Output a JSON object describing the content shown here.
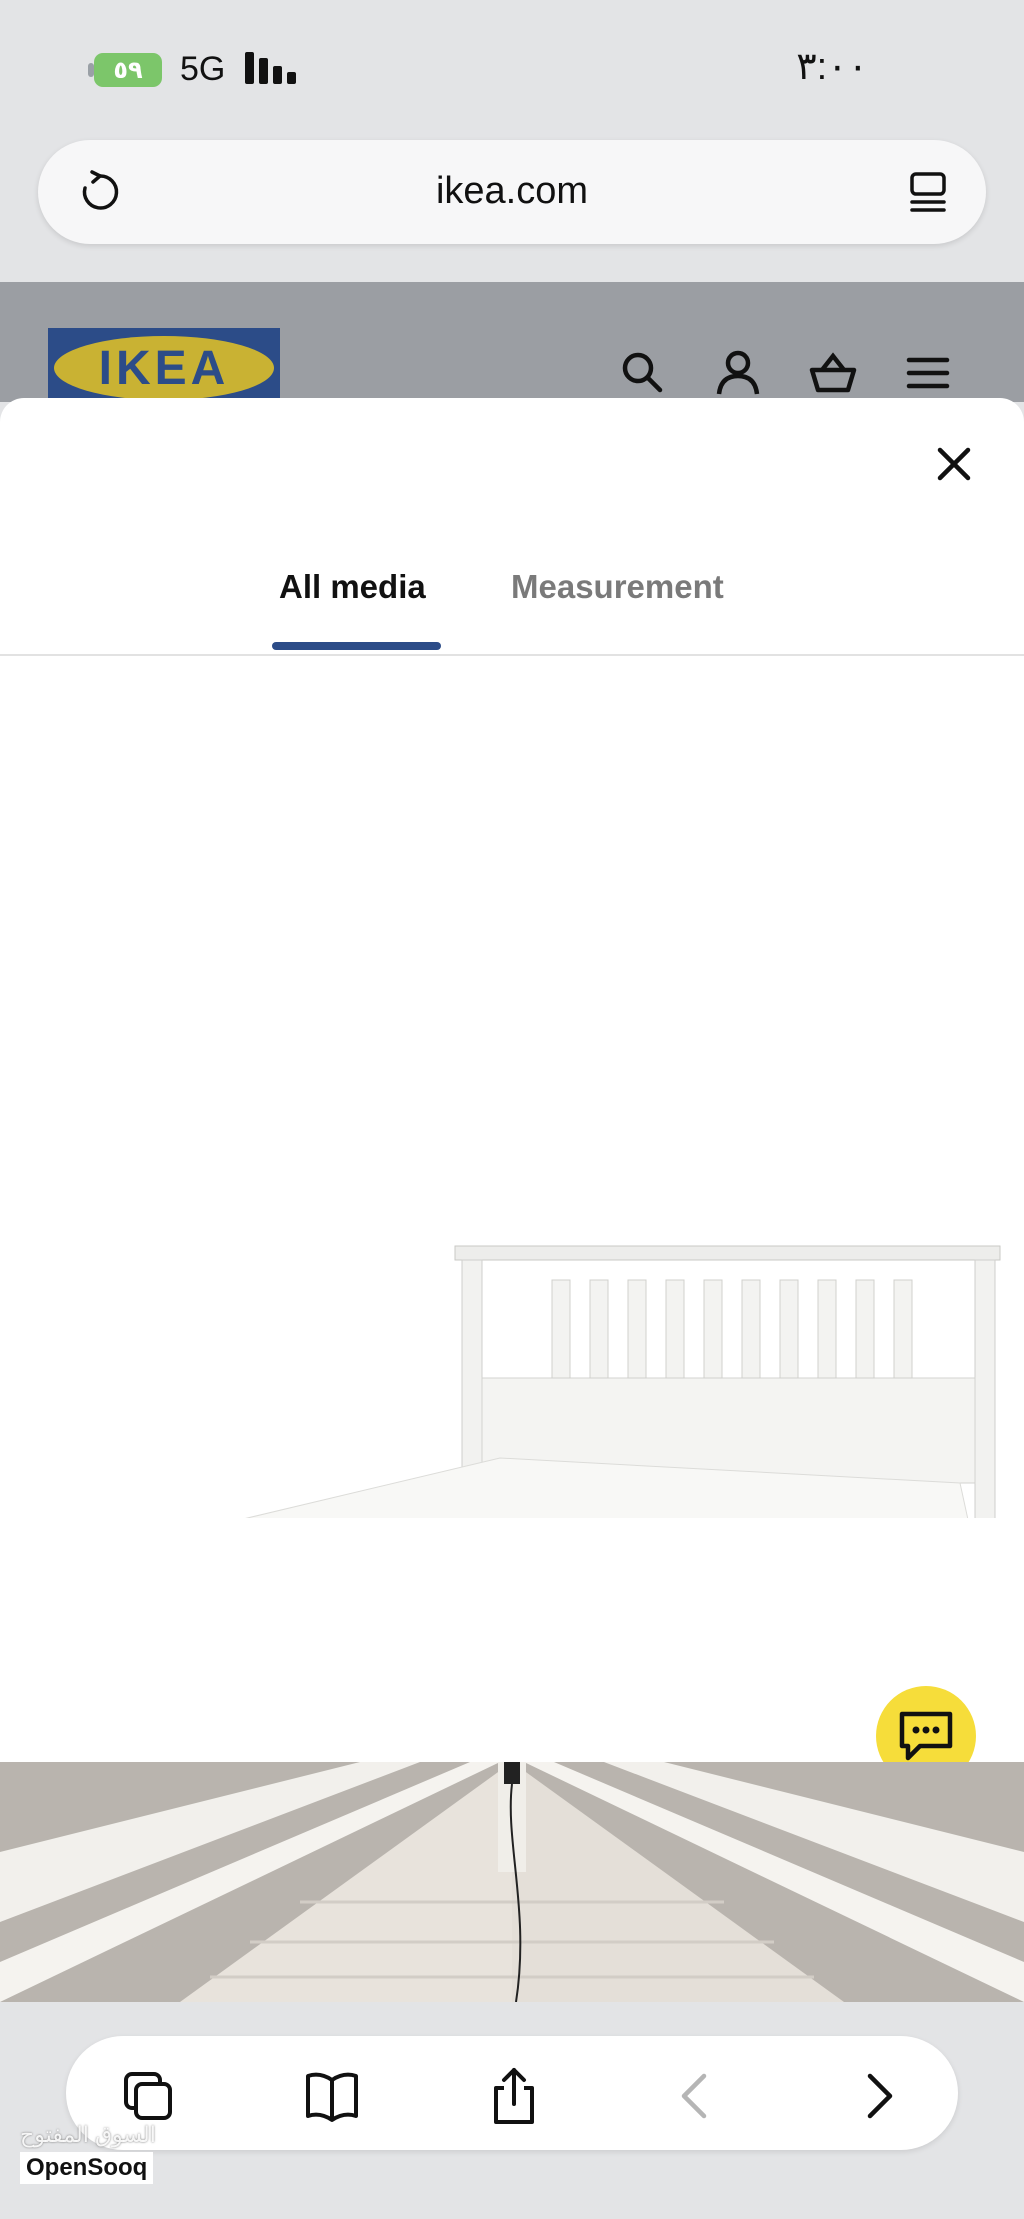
{
  "status_bar": {
    "battery": "٥٩",
    "network": "5G",
    "time": "٣:٠٠"
  },
  "browser": {
    "url": "ikea.com"
  },
  "site": {
    "logo_text": "IKEA"
  },
  "media_sheet": {
    "tabs": [
      {
        "label": "All media",
        "active": true
      },
      {
        "label": "Measurement",
        "active": false
      }
    ]
  },
  "watermark": {
    "arabic": "السوق المفتوح",
    "english": "OpenSooq"
  },
  "colors": {
    "brand_blue": "#2c4c88",
    "brand_yellow": "#f6dd3a",
    "battery_green": "#7cc66a"
  },
  "icons": [
    "reload-icon",
    "reader-icon",
    "search-icon",
    "account-icon",
    "basket-icon",
    "menu-icon",
    "close-icon",
    "chat-icon",
    "tabs-icon",
    "bookmarks-icon",
    "share-icon",
    "back-icon",
    "forward-icon"
  ]
}
